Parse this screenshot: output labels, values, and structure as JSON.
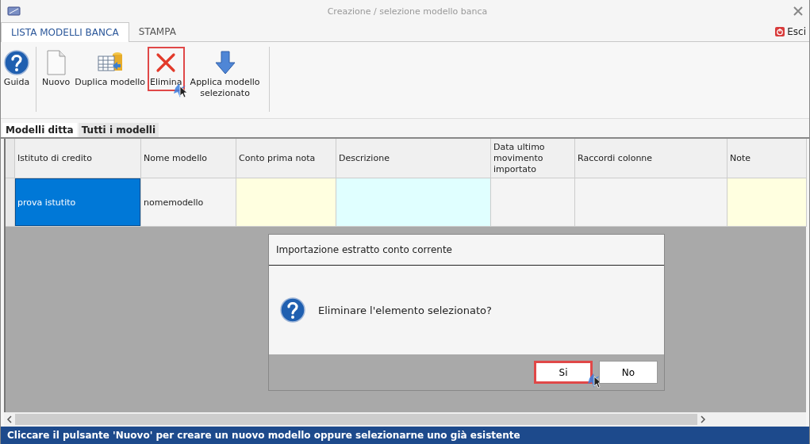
{
  "window": {
    "title": "Creazione / selezione modello banca"
  },
  "ribbon_tabs": [
    {
      "label": "LISTA MODELLI BANCA",
      "selected": true
    },
    {
      "label": "STAMPA",
      "selected": false
    }
  ],
  "exit_button": {
    "label": "Esci"
  },
  "toolbar": [
    {
      "kind": "help",
      "label": "Guida",
      "highlighted": false
    },
    {
      "kind": "new",
      "label": "Nuovo",
      "highlighted": false
    },
    {
      "kind": "duplicate",
      "label": "Duplica modello",
      "highlighted": false
    },
    {
      "kind": "delete",
      "label": "Elimina",
      "highlighted": true
    },
    {
      "kind": "apply",
      "label": "Applica modello selezionato",
      "highlighted": false
    }
  ],
  "sub_tabs": [
    {
      "label": "Modelli ditta",
      "selected": true
    },
    {
      "label": "Tutti i modelli",
      "selected": false
    }
  ],
  "table": {
    "columns": [
      "Istituto di credito",
      "Nome modello",
      "Conto prima nota",
      "Descrizione",
      "Data ultimo movimento importato",
      "Raccordi colonne",
      "Note"
    ],
    "rows": [
      {
        "cells": [
          {
            "text": "prova istutito",
            "selected": true,
            "color": "#0078d7"
          },
          {
            "text": "nomemodello",
            "selected": false,
            "color": "#f4f4f4"
          },
          {
            "text": "",
            "selected": false,
            "color": "#ffffe0"
          },
          {
            "text": "",
            "selected": false,
            "color": "#e0ffff"
          },
          {
            "text": "",
            "selected": false,
            "color": "#f4f4f4"
          },
          {
            "text": "",
            "selected": false,
            "color": "#f4f4f4"
          },
          {
            "text": "",
            "selected": false,
            "color": "#ffffe0"
          }
        ]
      }
    ]
  },
  "dialog": {
    "title": "Importazione estratto conto corrente",
    "message": "Eliminare l'elemento selezionato?",
    "buttons": [
      {
        "label": "Si",
        "highlighted": true
      },
      {
        "label": "No",
        "highlighted": false
      }
    ]
  },
  "status_bar": "Cliccare il pulsante 'Nuovo' per creare un nuovo modello oppure selezionarne uno già esistente"
}
